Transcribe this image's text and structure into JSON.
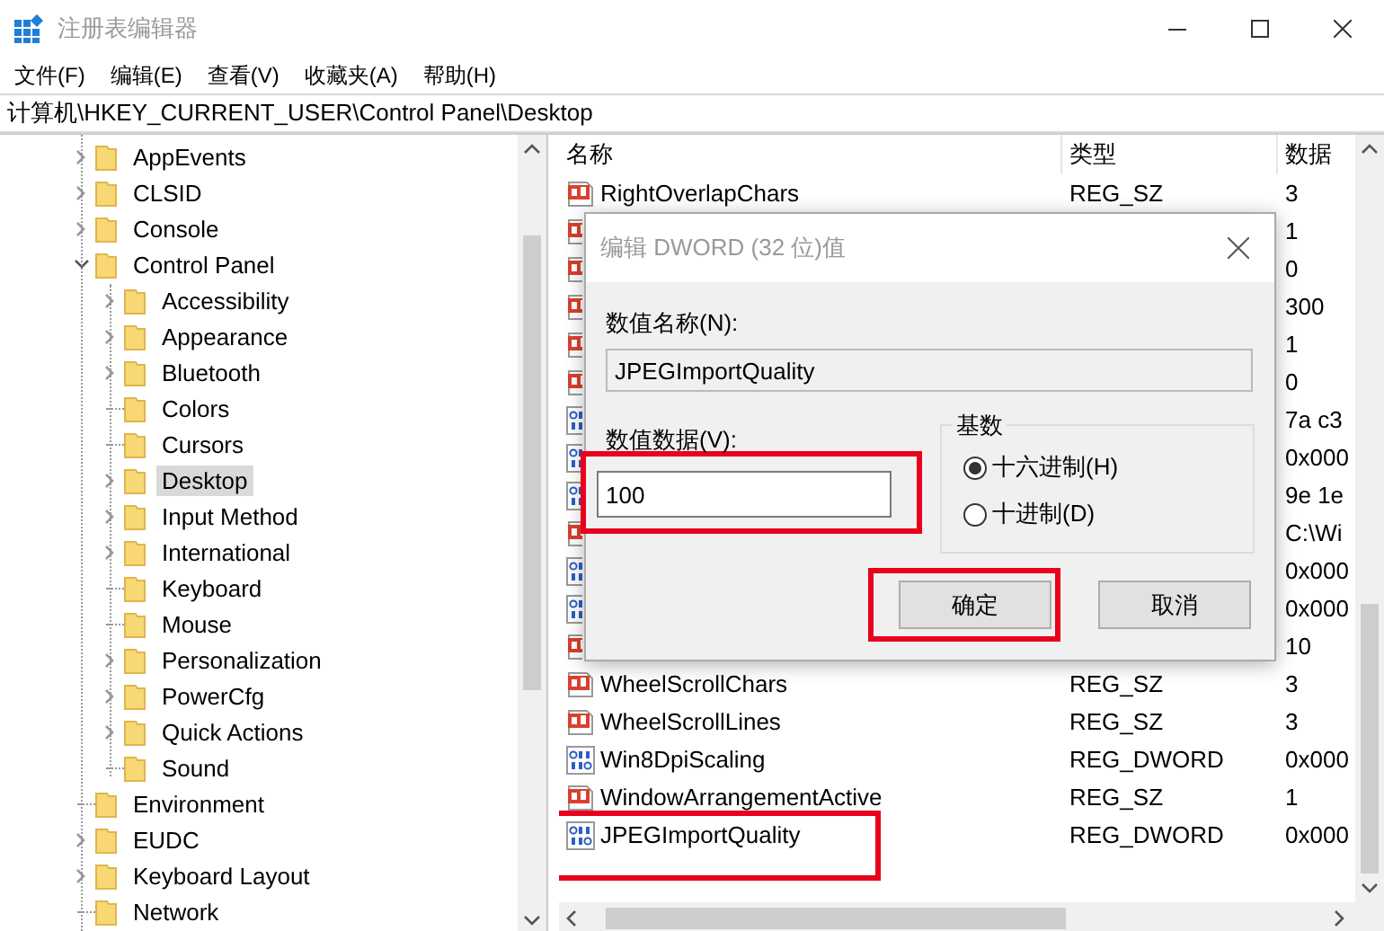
{
  "window": {
    "title": "注册表编辑器"
  },
  "menu": [
    "文件(F)",
    "编辑(E)",
    "查看(V)",
    "收藏夹(A)",
    "帮助(H)"
  ],
  "address": "计算机\\HKEY_CURRENT_USER\\Control Panel\\Desktop",
  "tree": [
    {
      "label": "AppEvents",
      "expandable": true,
      "expanded": false,
      "selected": false
    },
    {
      "label": "CLSID",
      "expandable": true,
      "expanded": false,
      "selected": false
    },
    {
      "label": "Console",
      "expandable": true,
      "expanded": false,
      "selected": false
    },
    {
      "label": "Control Panel",
      "expandable": true,
      "expanded": true,
      "selected": false,
      "children": [
        {
          "label": "Accessibility",
          "expandable": true,
          "expanded": false,
          "selected": false
        },
        {
          "label": "Appearance",
          "expandable": true,
          "expanded": false,
          "selected": false
        },
        {
          "label": "Bluetooth",
          "expandable": true,
          "expanded": false,
          "selected": false
        },
        {
          "label": "Colors",
          "expandable": false,
          "selected": false
        },
        {
          "label": "Cursors",
          "expandable": false,
          "selected": false
        },
        {
          "label": "Desktop",
          "expandable": true,
          "expanded": false,
          "selected": true
        },
        {
          "label": "Input Method",
          "expandable": true,
          "expanded": false,
          "selected": false
        },
        {
          "label": "International",
          "expandable": true,
          "expanded": false,
          "selected": false
        },
        {
          "label": "Keyboard",
          "expandable": false,
          "selected": false
        },
        {
          "label": "Mouse",
          "expandable": false,
          "selected": false
        },
        {
          "label": "Personalization",
          "expandable": true,
          "expanded": false,
          "selected": false
        },
        {
          "label": "PowerCfg",
          "expandable": true,
          "expanded": false,
          "selected": false
        },
        {
          "label": "Quick Actions",
          "expandable": true,
          "expanded": false,
          "selected": false
        },
        {
          "label": "Sound",
          "expandable": false,
          "selected": false
        }
      ]
    },
    {
      "label": "Environment",
      "expandable": false,
      "selected": false
    },
    {
      "label": "EUDC",
      "expandable": true,
      "expanded": false,
      "selected": false
    },
    {
      "label": "Keyboard Layout",
      "expandable": true,
      "expanded": false,
      "selected": false
    },
    {
      "label": "Network",
      "expandable": false,
      "selected": false
    }
  ],
  "table": {
    "columns": [
      "名称",
      "类型",
      "数据"
    ],
    "rows": [
      {
        "kind": "string",
        "name": "RightOverlapChars",
        "type": "REG_SZ",
        "data": "3",
        "highlighted": false
      },
      {
        "kind": "string",
        "data": "1",
        "highlighted": false
      },
      {
        "kind": "string",
        "data": "0",
        "highlighted": false
      },
      {
        "kind": "string",
        "data": "300",
        "highlighted": false
      },
      {
        "kind": "string",
        "data": "1",
        "highlighted": false
      },
      {
        "kind": "string",
        "data": "0",
        "highlighted": false
      },
      {
        "kind": "dword",
        "data": "7a c3",
        "highlighted": false
      },
      {
        "kind": "dword",
        "data": "0x000",
        "highlighted": false
      },
      {
        "kind": "dword",
        "data": "9e 1e",
        "highlighted": false
      },
      {
        "kind": "string",
        "data": "C:\\Wi",
        "highlighted": false
      },
      {
        "kind": "dword",
        "data": "0x000",
        "highlighted": false
      },
      {
        "kind": "dword",
        "data": "0x000",
        "highlighted": false
      },
      {
        "kind": "string",
        "data": "10",
        "highlighted": false
      },
      {
        "kind": "string",
        "name": "WheelScrollChars",
        "type": "REG_SZ",
        "data": "3",
        "highlighted": false
      },
      {
        "kind": "string",
        "name": "WheelScrollLines",
        "type": "REG_SZ",
        "data": "3",
        "highlighted": false
      },
      {
        "kind": "dword",
        "name": "Win8DpiScaling",
        "type": "REG_DWORD",
        "data": "0x000",
        "highlighted": false
      },
      {
        "kind": "string",
        "name": "WindowArrangementActive",
        "type": "REG_SZ",
        "data": "1",
        "highlighted": false
      },
      {
        "kind": "dword",
        "name": "JPEGImportQuality",
        "type": "REG_DWORD",
        "data": "0x000",
        "highlighted": true
      }
    ]
  },
  "dialog": {
    "title": "编辑 DWORD (32 位)值",
    "name_label": "数值名称(N):",
    "name_value": "JPEGImportQuality",
    "data_label": "数值数据(V):",
    "data_value": "100",
    "data_highlighted": true,
    "base_label": "基数",
    "radios": [
      {
        "label": "十六进制(H)",
        "selected": true
      },
      {
        "label": "十进制(D)",
        "selected": false
      }
    ],
    "buttons": [
      {
        "label": "确定",
        "highlighted": true
      },
      {
        "label": "取消",
        "highlighted": false
      }
    ]
  }
}
